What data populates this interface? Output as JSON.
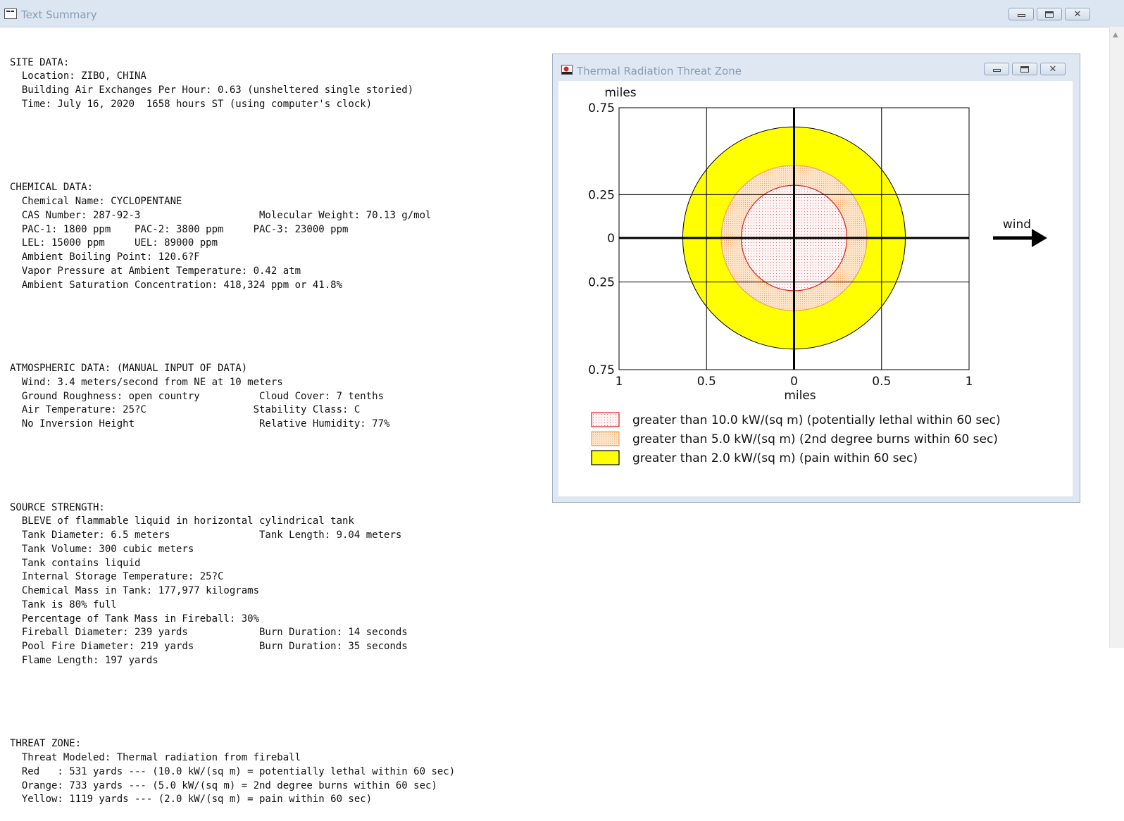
{
  "window": {
    "title": "Text Summary"
  },
  "text_summary": {
    "site": [
      "SITE DATA:",
      "  Location: ZIBO, CHINA",
      "  Building Air Exchanges Per Hour: 0.63 (unsheltered single storied)",
      "  Time: July 16, 2020  1658 hours ST (using computer's clock)"
    ],
    "chemical": [
      "CHEMICAL DATA:",
      "  Chemical Name: CYCLOPENTANE",
      "  CAS Number: 287-92-3                    Molecular Weight: 70.13 g/mol",
      "  PAC-1: 1800 ppm    PAC-2: 3800 ppm     PAC-3: 23000 ppm",
      "  LEL: 15000 ppm     UEL: 89000 ppm",
      "  Ambient Boiling Point: 120.6?F",
      "  Vapor Pressure at Ambient Temperature: 0.42 atm",
      "  Ambient Saturation Concentration: 418,324 ppm or 41.8%"
    ],
    "atmospheric": [
      "ATMOSPHERIC DATA: (MANUAL INPUT OF DATA)",
      "  Wind: 3.4 meters/second from NE at 10 meters",
      "  Ground Roughness: open country          Cloud Cover: 7 tenths",
      "  Air Temperature: 25?C                  Stability Class: C",
      "  No Inversion Height                     Relative Humidity: 77%"
    ],
    "source": [
      "SOURCE STRENGTH:",
      "  BLEVE of flammable liquid in horizontal cylindrical tank",
      "  Tank Diameter: 6.5 meters               Tank Length: 9.04 meters",
      "  Tank Volume: 300 cubic meters",
      "  Tank contains liquid",
      "  Internal Storage Temperature: 25?C",
      "  Chemical Mass in Tank: 177,977 kilograms",
      "  Tank is 80% full",
      "  Percentage of Tank Mass in Fireball: 30%",
      "  Fireball Diameter: 239 yards            Burn Duration: 14 seconds",
      "  Pool Fire Diameter: 219 yards           Burn Duration: 35 seconds",
      "  Flame Length: 197 yards"
    ],
    "threat": [
      "THREAT ZONE:",
      "  Threat Modeled: Thermal radiation from fireball",
      "  Red   : 531 yards --- (10.0 kW/(sq m) = potentially lethal within 60 sec)",
      "  Orange: 733 yards --- (5.0 kW/(sq m) = 2nd degree burns within 60 sec)",
      "  Yellow: 1119 yards --- (2.0 kW/(sq m) = pain within 60 sec)"
    ]
  },
  "chart_window": {
    "title": "Thermal Radiation Threat Zone"
  },
  "chart_data": {
    "type": "area",
    "units": "miles",
    "ylabel": "miles",
    "xlabel": "miles",
    "xlim": [
      -1,
      1
    ],
    "ylim": [
      -0.75,
      0.75
    ],
    "x_ticks": [
      {
        "value": -1,
        "label": "1"
      },
      {
        "value": -0.5,
        "label": "0.5"
      },
      {
        "value": 0,
        "label": "0"
      },
      {
        "value": 0.5,
        "label": "0.5"
      },
      {
        "value": 1,
        "label": "1"
      }
    ],
    "y_ticks": [
      {
        "value": 0.75,
        "label": "0.75"
      },
      {
        "value": 0.25,
        "label": "0.25"
      },
      {
        "value": 0,
        "label": "0"
      },
      {
        "value": -0.25,
        "label": "0.25"
      },
      {
        "value": -0.75,
        "label": "0.75"
      }
    ],
    "grid": true,
    "zones": [
      {
        "color": "#ffff00",
        "radius_miles": 0.636,
        "legend": "greater than 2.0 kW/(sq m) (pain within 60 sec)"
      },
      {
        "color": "#fcd9b6",
        "radius_miles": 0.416,
        "legend": "greater than 5.0 kW/(sq m) (2nd degree burns within 60 sec)"
      },
      {
        "color": "#fff0f0",
        "radius_miles": 0.302,
        "legend": "greater than 10.0 kW/(sq m) (potentially lethal within 60 sec)"
      }
    ],
    "legend_order": [
      2,
      1,
      0
    ],
    "wind_label": "wind",
    "wind_direction": "east",
    "legend_placement": "bottom"
  }
}
